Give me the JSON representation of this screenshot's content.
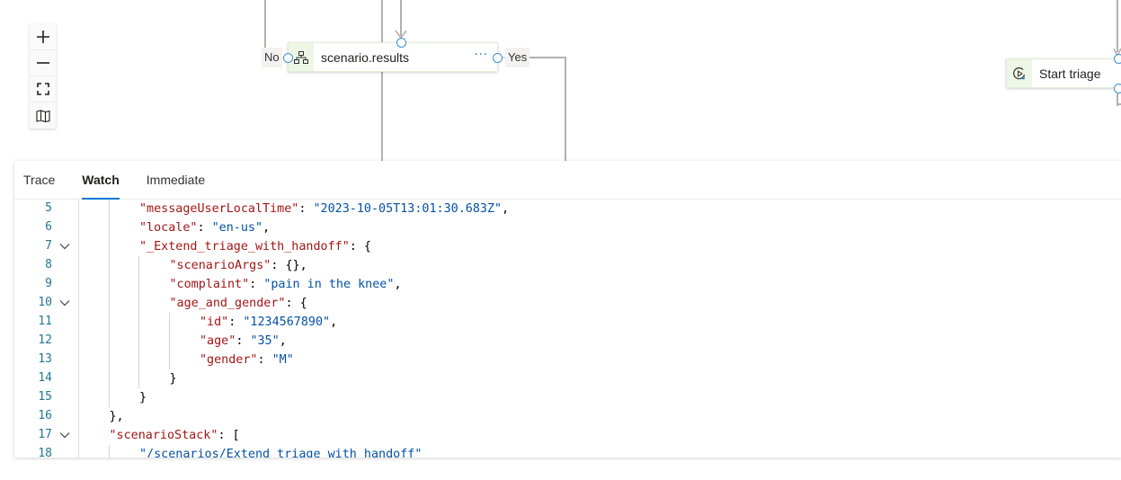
{
  "canvas": {
    "zoom_controls": [
      {
        "name": "zoom-in",
        "icon": "plus-icon"
      },
      {
        "name": "zoom-out",
        "icon": "minus-icon"
      },
      {
        "name": "fit-to-screen",
        "icon": "fit-screen-icon"
      },
      {
        "name": "minimap",
        "icon": "map-icon"
      }
    ],
    "nodes": {
      "condition": {
        "title": "scenario.results",
        "icon": "branch-icon",
        "more": "···",
        "no_label": "No",
        "yes_label": "Yes"
      },
      "start": {
        "title": "Start triage",
        "icon": "begin-dialog-icon"
      }
    }
  },
  "debug_panel": {
    "tabs": [
      {
        "label": "Trace",
        "active": false
      },
      {
        "label": "Watch",
        "active": true
      },
      {
        "label": "Immediate",
        "active": false
      }
    ],
    "lines": [
      {
        "n": "5",
        "fold": false,
        "indent": 2,
        "tokens": [
          [
            "k",
            "\"messageUserLocalTime\""
          ],
          [
            "p",
            ": "
          ],
          [
            "s",
            "\"2023-10-05T13:01:30.683Z\""
          ],
          [
            "p",
            ","
          ]
        ]
      },
      {
        "n": "6",
        "fold": false,
        "indent": 2,
        "tokens": [
          [
            "k",
            "\"locale\""
          ],
          [
            "p",
            ": "
          ],
          [
            "s",
            "\"en-us\""
          ],
          [
            "p",
            ","
          ]
        ]
      },
      {
        "n": "7",
        "fold": true,
        "indent": 2,
        "tokens": [
          [
            "k",
            "\"_Extend_triage_with_handoff\""
          ],
          [
            "p",
            ": {"
          ]
        ]
      },
      {
        "n": "8",
        "fold": false,
        "indent": 3,
        "tokens": [
          [
            "k",
            "\"scenarioArgs\""
          ],
          [
            "p",
            ": {},"
          ]
        ]
      },
      {
        "n": "9",
        "fold": false,
        "indent": 3,
        "tokens": [
          [
            "k",
            "\"complaint\""
          ],
          [
            "p",
            ": "
          ],
          [
            "s",
            "\"pain in the knee\""
          ],
          [
            "p",
            ","
          ]
        ]
      },
      {
        "n": "10",
        "fold": true,
        "indent": 3,
        "tokens": [
          [
            "k",
            "\"age_and_gender\""
          ],
          [
            "p",
            ": {"
          ]
        ]
      },
      {
        "n": "11",
        "fold": false,
        "indent": 4,
        "tokens": [
          [
            "k",
            "\"id\""
          ],
          [
            "p",
            ": "
          ],
          [
            "s",
            "\"1234567890\""
          ],
          [
            "p",
            ","
          ]
        ]
      },
      {
        "n": "12",
        "fold": false,
        "indent": 4,
        "tokens": [
          [
            "k",
            "\"age\""
          ],
          [
            "p",
            ": "
          ],
          [
            "s",
            "\"35\""
          ],
          [
            "p",
            ","
          ]
        ]
      },
      {
        "n": "13",
        "fold": false,
        "indent": 4,
        "tokens": [
          [
            "k",
            "\"gender\""
          ],
          [
            "p",
            ": "
          ],
          [
            "s",
            "\"M\""
          ]
        ]
      },
      {
        "n": "14",
        "fold": false,
        "indent": 3,
        "tokens": [
          [
            "p",
            "}"
          ]
        ]
      },
      {
        "n": "15",
        "fold": false,
        "indent": 2,
        "tokens": [
          [
            "p",
            "}"
          ]
        ]
      },
      {
        "n": "16",
        "fold": false,
        "indent": 1,
        "tokens": [
          [
            "p",
            "},"
          ]
        ]
      },
      {
        "n": "17",
        "fold": true,
        "indent": 1,
        "tokens": [
          [
            "k",
            "\"scenarioStack\""
          ],
          [
            "p",
            ": ["
          ]
        ]
      },
      {
        "n": "18",
        "fold": false,
        "indent": 2,
        "tokens": [
          [
            "s",
            "\"/scenarios/Extend triage with handoff\""
          ]
        ]
      }
    ]
  },
  "colors": {
    "accent": "#0078d4",
    "json_key": "#a31515",
    "json_string": "#0451a5",
    "line_number": "#237893",
    "node_icon_bg": "#eef6e6",
    "port": "#3a8fd6",
    "connector": "#b3b0ad"
  }
}
